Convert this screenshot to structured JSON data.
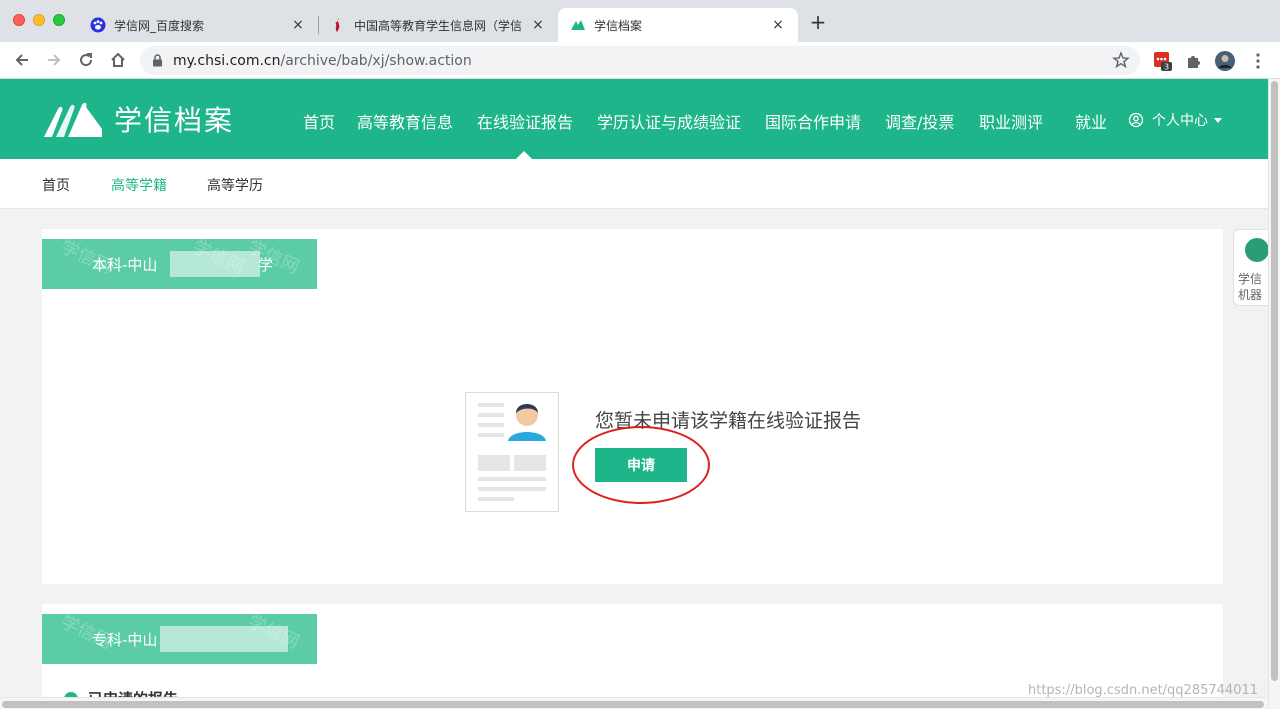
{
  "browser": {
    "tabs": [
      {
        "title": "学信网_百度搜索",
        "close": "×"
      },
      {
        "title": "中国高等教育学生信息网（学信",
        "close": "×"
      },
      {
        "title": "学信档案",
        "close": "×"
      }
    ],
    "new_tab": "+",
    "url_host": "my.chsi.com.cn",
    "url_path": "/archive/bab/xj/show.action",
    "extension_badge": "3"
  },
  "header": {
    "logo_text": "学信档案",
    "nav": [
      "首页",
      "高等教育信息",
      "在线验证报告",
      "学历认证与成绩验证",
      "国际合作申请",
      "调查/投票",
      "职业测评",
      "就业"
    ],
    "user_menu": "个人中心"
  },
  "subnav": {
    "items": [
      "首页",
      "高等学籍",
      "高等学历"
    ],
    "active": "高等学籍"
  },
  "cards": [
    {
      "label": "本科-中山",
      "label_tail": "学",
      "watermark": "学信网",
      "empty_text": "您暂未申请该学籍在线验证报告",
      "apply_button": "申请"
    },
    {
      "label": "专科-中山",
      "watermark": "学信网",
      "section_title": "已申请的报告"
    }
  ],
  "side_widget": {
    "line1": "学信",
    "line2": "机器"
  },
  "page_watermark": "https://blog.csdn.net/qq285744011",
  "colors": {
    "brand_green": "#1fb58a",
    "label_green": "#5ccca7",
    "annotation_red": "#e02020"
  }
}
